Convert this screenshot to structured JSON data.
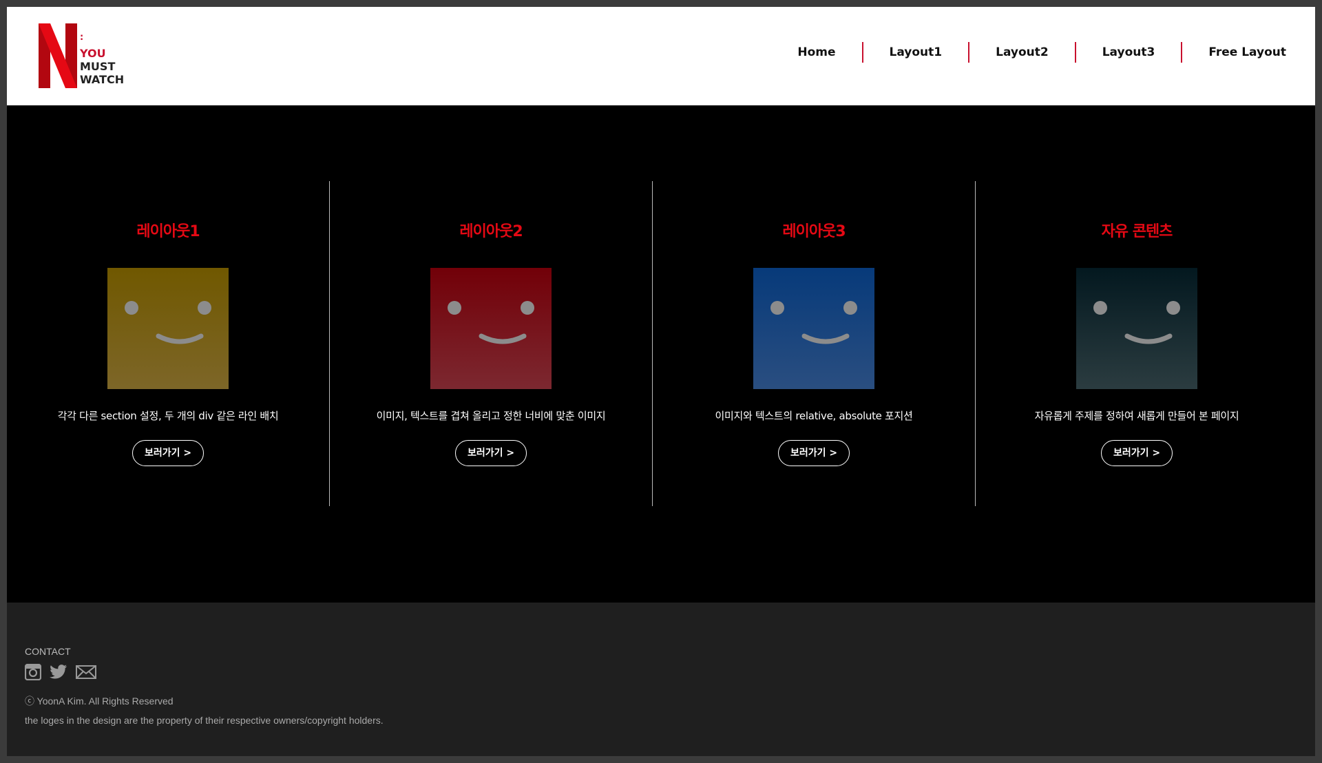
{
  "header": {
    "logo": {
      "letter": "N",
      "colon": ":",
      "lines": [
        "YOU",
        "MUST",
        "WATCH"
      ],
      "brand_color": "#e50914"
    },
    "nav": [
      {
        "label": "Home"
      },
      {
        "label": "Layout1"
      },
      {
        "label": "Layout2"
      },
      {
        "label": "Layout3"
      },
      {
        "label": "Free Layout"
      }
    ],
    "separator_color": "#c8102e"
  },
  "main": {
    "cards": [
      {
        "title": "레이아웃1",
        "description": "각각 다른 section 설정, 두 개의 div 같은 라인 배치",
        "button": "보러가기 >",
        "thumb_color_top": "#705800",
        "thumb_color_bottom": "#7d6628",
        "icon": "smile-face-icon"
      },
      {
        "title": "레이아웃2",
        "description": "이미지, 텍스트를 겹쳐 올리고 정한 너비에 맞춘 이미지",
        "button": "보러가기 >",
        "thumb_color_top": "#720008",
        "thumb_color_bottom": "#7c2830",
        "icon": "smile-face-icon"
      },
      {
        "title": "레이아웃3",
        "description": "이미지와 텍스트의 relative, absolute 포지션",
        "button": "보러가기 >",
        "thumb_color_top": "#073a7a",
        "thumb_color_bottom": "#2a4e80",
        "icon": "smile-face-icon"
      },
      {
        "title": "자유 콘텐츠",
        "description": "자유롭게 주제를 정하여 새롭게 만들어 본 페이지",
        "button": "보러가기 >",
        "thumb_color_top": "#03181f",
        "thumb_color_bottom": "#2b3c40",
        "icon": "smile-face-icon"
      }
    ],
    "title_color": "#e50914"
  },
  "footer": {
    "contact_label": "CONTACT",
    "social_icons": [
      "instagram-icon",
      "twitter-icon",
      "mail-icon"
    ],
    "copyright": "ⓒ YoonA Kim. All Rights Reserved",
    "disclaimer": "the loges in the design are the property of their respective owners/copyright holders."
  }
}
